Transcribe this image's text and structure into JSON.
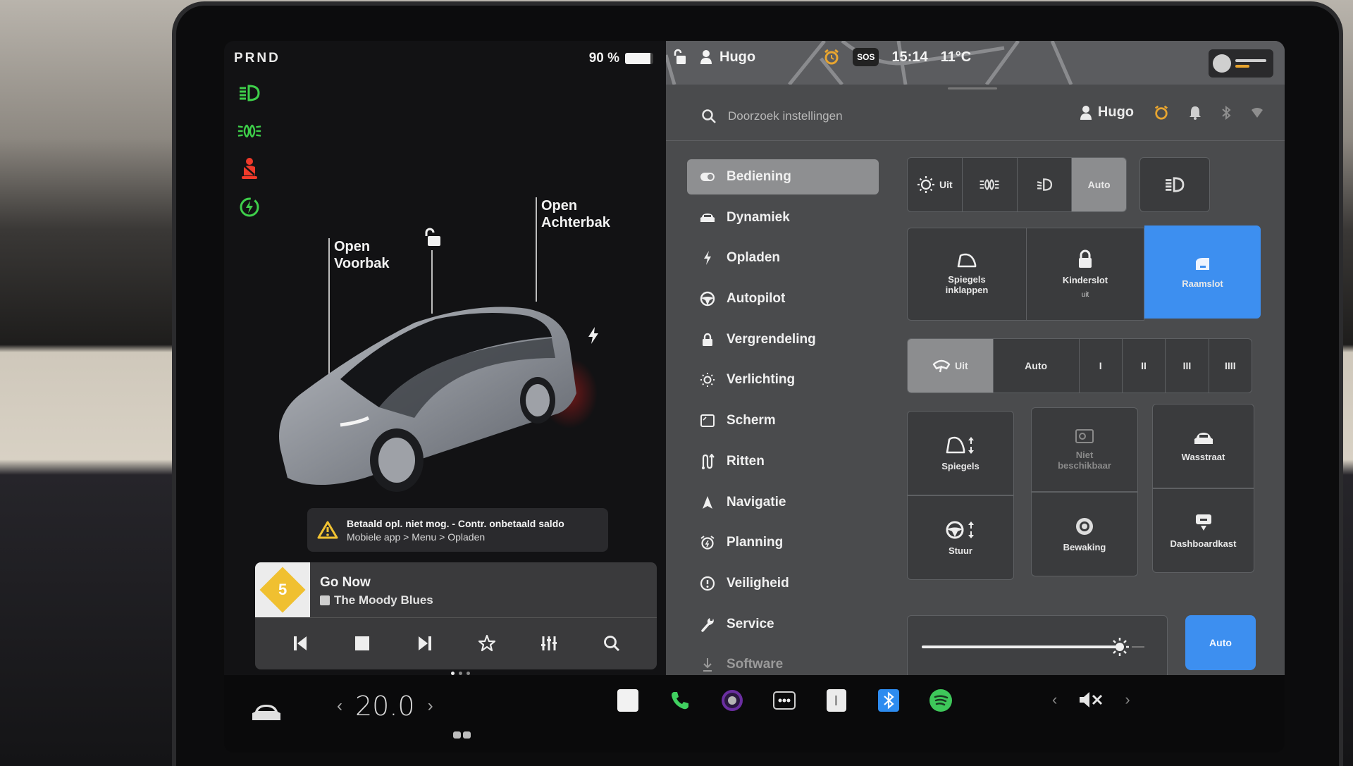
{
  "left_panel": {
    "gear": "PRND",
    "battery_percent_label": "90 %",
    "battery_fill": 0.9,
    "telltales": [
      "low-beam-icon",
      "parking-lights-icon",
      "seatbelt-warning-icon",
      "regen-icon"
    ],
    "callouts": {
      "frunk": [
        "Open",
        "Voorbak"
      ],
      "trunk": [
        "Open",
        "Achterbak"
      ]
    },
    "alert": {
      "line1": "Betaald opl. niet mog. - Contr. onbetaald saldo",
      "line2": "Mobiele app > Menu > Opladen"
    },
    "media": {
      "station_badge": "5",
      "title": "Go Now",
      "artist": "The Moody Blues",
      "controls": [
        "previous",
        "stop",
        "next",
        "favorite",
        "equalizer",
        "search"
      ]
    }
  },
  "status_bar": {
    "user": "Hugo",
    "sos": "SOS",
    "time": "15:14",
    "temperature": "11°C"
  },
  "settings": {
    "search_placeholder": "Doorzoek instellingen",
    "profile_name": "Hugo",
    "nav": [
      {
        "label": "Bediening",
        "icon": "toggle-icon",
        "active": true
      },
      {
        "label": "Dynamiek",
        "icon": "car-icon"
      },
      {
        "label": "Opladen",
        "icon": "bolt-icon"
      },
      {
        "label": "Autopilot",
        "icon": "steering-wheel-icon"
      },
      {
        "label": "Vergrendeling",
        "icon": "lock-icon"
      },
      {
        "label": "Verlichting",
        "icon": "sun-icon"
      },
      {
        "label": "Scherm",
        "icon": "display-icon"
      },
      {
        "label": "Ritten",
        "icon": "trips-icon"
      },
      {
        "label": "Navigatie",
        "icon": "navigation-arrow-icon"
      },
      {
        "label": "Planning",
        "icon": "alarm-clock-icon"
      },
      {
        "label": "Veiligheid",
        "icon": "alert-circle-icon"
      },
      {
        "label": "Service",
        "icon": "wrench-icon"
      },
      {
        "label": "Software",
        "icon": "download-icon",
        "dim": true
      }
    ],
    "lights": {
      "options": [
        "Uit",
        "",
        "",
        "Auto"
      ],
      "selected": "Auto",
      "high_beam": ""
    },
    "tiles_row1": [
      {
        "label": "Spiegels inklappen",
        "sub": ""
      },
      {
        "label": "Kinderslot",
        "sub": "uit"
      },
      {
        "label": "Raamslot",
        "sub": "",
        "active": true
      }
    ],
    "wipers": {
      "options": [
        "Uit",
        "Auto",
        "I",
        "II",
        "III",
        "IIII"
      ],
      "selected": "Uit"
    },
    "tiles_grid": [
      {
        "label": "Spiegels"
      },
      {
        "label": "Niet beschikbaar",
        "disabled": true
      },
      {
        "label": "Wasstraat"
      },
      {
        "label": "Stuur"
      },
      {
        "label": "Bewaking"
      },
      {
        "label": "Dashboardkast"
      }
    ],
    "brightness": {
      "value": 0.85,
      "auto_label": "Auto"
    }
  },
  "dock": {
    "cabin_temperature": "20.0",
    "apps": [
      "notes-app",
      "phone-app",
      "camera-app",
      "more-apps",
      "calendar-app",
      "bluetooth-app",
      "spotify-app"
    ],
    "volume_state": "muted"
  },
  "colors": {
    "accent_blue": "#3d8ff0",
    "telltale_green": "#3ecf4a",
    "telltale_red": "#ef3a2a",
    "alert_yellow": "#f1c232",
    "alarm_orange": "#e8a530"
  }
}
